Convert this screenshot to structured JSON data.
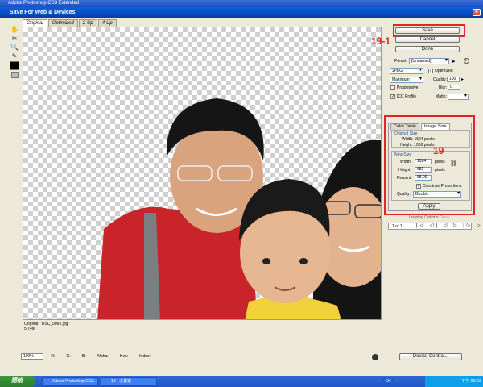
{
  "app_title": "Adobe Photoshop CS3 Extended",
  "dialog_title": "Save For Web & Devices",
  "tabs": [
    "Original",
    "Optimized",
    "2-Up",
    "4-Up"
  ],
  "image_info": {
    "name": "Original: \"DSC_0092.jpg\"",
    "size": "5.74M"
  },
  "status": {
    "zoom": "100%",
    "r": "R: --",
    "g": "G: --",
    "b": "B: --",
    "alpha": "Alpha: --",
    "hex": "Hex: --",
    "index": "Index: --"
  },
  "buttons": {
    "save": "Save",
    "cancel": "Cancel",
    "done": "Done",
    "apply": "Apply",
    "device_central": "Device Central..."
  },
  "annotations": {
    "save_note": "19-1",
    "size_note": "19"
  },
  "preset": {
    "label": "Preset:",
    "value": "[Unnamed]"
  },
  "format": "JPEG",
  "optimized_label": "Optimized",
  "quality_level": "Maximum",
  "quality": {
    "label": "Quality:",
    "value": "100"
  },
  "progressive_label": "Progressive",
  "blur": {
    "label": "Blur:",
    "value": "0"
  },
  "icc_label": "ICC Profile",
  "matte_label": "Matte:",
  "subtabs": [
    "Color Table",
    "Image Size"
  ],
  "original_size": {
    "title": "Original Size",
    "width": "Width: 1504 pixels",
    "height": "Height: 1000 pixels"
  },
  "new_size": {
    "title": "New Size",
    "width_label": "Width:",
    "width": "1024",
    "height_label": "Height:",
    "height": "681",
    "unit": "pixels",
    "percent_label": "Percent:",
    "percent": "68.09",
    "constrain": "Constrain Proportions",
    "quality_label": "Quality:",
    "quality_value": "Bicubic"
  },
  "looping": "Looping Options:",
  "looping_value": "Once",
  "frames": "1 of 1",
  "taskbar": {
    "start": "開始",
    "task1": "Adobe Photoshop CS3...",
    "task2": "18 - 小畫家",
    "lang": "CH",
    "clock": "下午 08:33"
  }
}
